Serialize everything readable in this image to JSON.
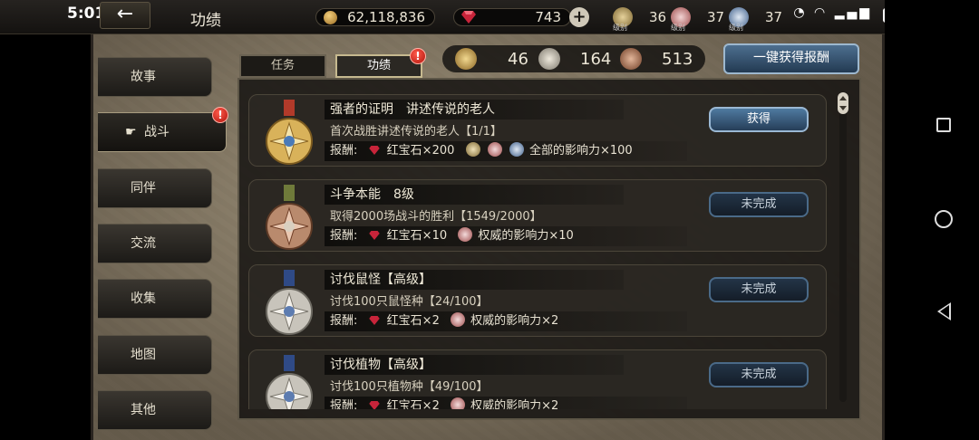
{
  "status_bar": {
    "time": "5:01"
  },
  "header": {
    "back_label": "←",
    "title": "功绩",
    "gold": "62,118,836",
    "gems": "743",
    "plus_label": "+",
    "rank_caption": "级别",
    "ranks": [
      "36",
      "37",
      "37"
    ]
  },
  "tabs": [
    {
      "label": "任务"
    },
    {
      "label": "功绩"
    }
  ],
  "medal_counts": [
    "46",
    "164",
    "513"
  ],
  "claim_all_label": "一键获得报酬",
  "sidebar": {
    "items": [
      {
        "label": "故事"
      },
      {
        "label": "战斗"
      },
      {
        "label": "同伴"
      },
      {
        "label": "交流"
      },
      {
        "label": "收集"
      },
      {
        "label": "地图"
      },
      {
        "label": "其他"
      }
    ],
    "active_index": 1
  },
  "alert_mark": "!",
  "entries": [
    {
      "title": "强者的证明　讲述传说的老人",
      "desc": "首次战胜讲述传说的老人【1/1】",
      "reward_label": "报酬:",
      "gem_reward": "红宝石×200",
      "influence": "全部的影响力×100",
      "button": "获得",
      "medal": "gold"
    },
    {
      "title": "斗争本能　8级",
      "desc": "取得2000场战斗的胜利【1549/2000】",
      "reward_label": "报酬:",
      "gem_reward": "红宝石×10",
      "influence": "权威的影响力×10",
      "button": "未完成",
      "medal": "bronze"
    },
    {
      "title": "讨伐鼠怪【高级】",
      "desc": "讨伐100只鼠怪种【24/100】",
      "reward_label": "报酬:",
      "gem_reward": "红宝石×2",
      "influence": "权威的影响力×2",
      "button": "未完成",
      "medal": "silver"
    },
    {
      "title": "讨伐植物【高级】",
      "desc": "讨伐100只植物种【49/100】",
      "reward_label": "报酬:",
      "gem_reward": "红宝石×2",
      "influence": "权威的影响力×2",
      "button": "未完成",
      "medal": "silver"
    }
  ],
  "colors": {
    "gold_medal": "#d9b25a",
    "bronze_medal": "#b98a6d",
    "silver_medal": "#c8c4bb",
    "gem": "#c8243a",
    "claim_button": "#3f6a91"
  }
}
